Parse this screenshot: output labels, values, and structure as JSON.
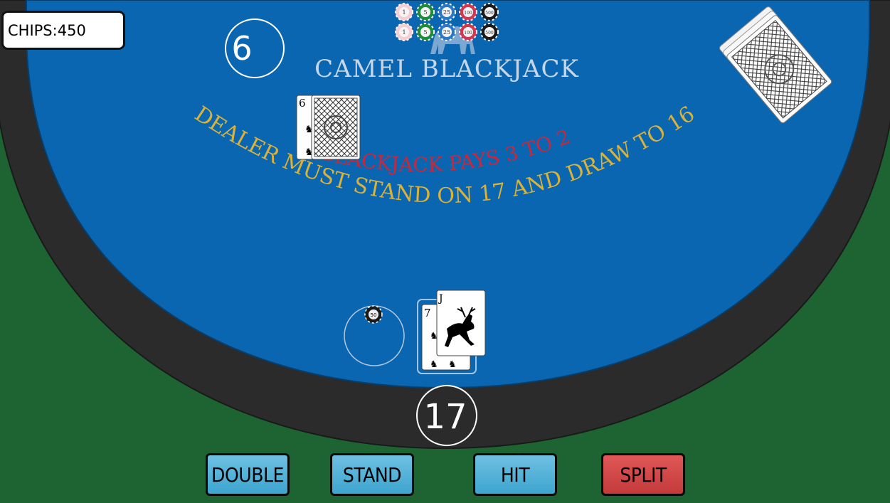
{
  "hud": {
    "chips_label": "CHIPS:",
    "chips_value": "450"
  },
  "table": {
    "title": "CAMEL BLACKJACK",
    "pays_text": "BLACKJACK PAYS 3 TO 2",
    "rule_text": "DEALER MUST STAND ON 17 AND DRAW TO 16",
    "dealer_total": "6",
    "player_total": "17",
    "bet_chip_value": "50"
  },
  "chip_rack": {
    "values": [
      "1",
      "5",
      "25",
      "100",
      "500"
    ],
    "colors": [
      "#f6cdd3",
      "#1e8c3a",
      "#2a78c8",
      "#d43550",
      "#1a1a1a"
    ]
  },
  "dealer_hand": [
    {
      "rank": "6",
      "suit": "camel",
      "face_up": true
    },
    {
      "face_up": false
    }
  ],
  "player_hand": [
    {
      "rank": "7",
      "suit": "camel",
      "face_up": true
    },
    {
      "rank": "J",
      "suit": "deer",
      "face_up": true
    }
  ],
  "actions": {
    "double": "DOUBLE",
    "stand": "STAND",
    "hit": "HIT",
    "split": "SPLIT"
  },
  "colors": {
    "felt_blue": "#0a66b0",
    "rail": "#2b2b2b",
    "floor_green": "#1e6433",
    "rule_gold": "#d9b23a",
    "pays_red": "#c8283c",
    "title": "#c7d6e6"
  }
}
